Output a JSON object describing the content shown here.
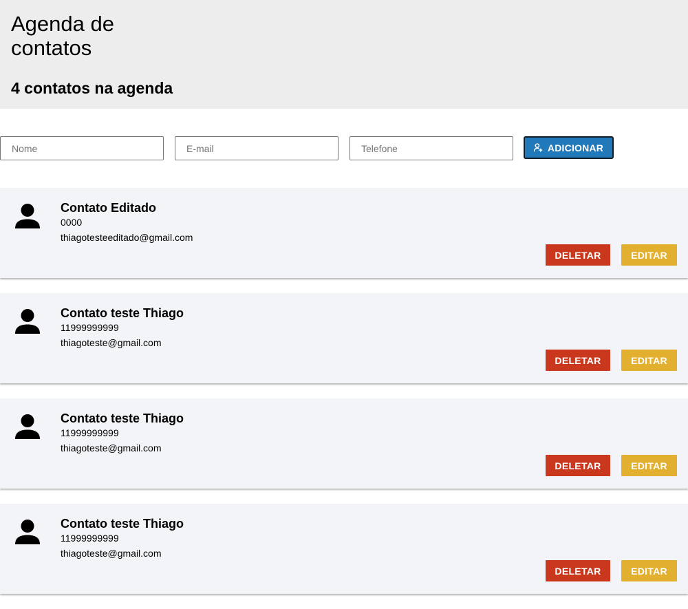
{
  "header": {
    "title": "Agenda de contatos",
    "count_text": "4 contatos na agenda"
  },
  "form": {
    "name_placeholder": "Nome",
    "email_placeholder": "E-mail",
    "phone_placeholder": "Telefone",
    "name_value": "",
    "email_value": "",
    "phone_value": "",
    "add_label": "ADICIONAR",
    "add_icon": "add-user-icon"
  },
  "contacts": [
    {
      "name": "Contato Editado",
      "phone": "0000",
      "email": "thiagotesteeditado@gmail.com",
      "delete_label": "DELETAR",
      "edit_label": "EDITAR",
      "avatar_icon": "person-icon"
    },
    {
      "name": "Contato teste Thiago",
      "phone": "11999999999",
      "email": "thiagoteste@gmail.com",
      "delete_label": "DELETAR",
      "edit_label": "EDITAR",
      "avatar_icon": "person-icon"
    },
    {
      "name": "Contato teste Thiago",
      "phone": "11999999999",
      "email": "thiagoteste@gmail.com",
      "delete_label": "DELETAR",
      "edit_label": "EDITAR",
      "avatar_icon": "person-icon"
    },
    {
      "name": "Contato teste Thiago",
      "phone": "11999999999",
      "email": "thiagoteste@gmail.com",
      "delete_label": "DELETAR",
      "edit_label": "EDITAR",
      "avatar_icon": "person-icon"
    }
  ],
  "colors": {
    "header_bg": "#ededed",
    "card_bg": "#f3f4f7",
    "add_button": "#2279b9",
    "delete_button": "#c9381c",
    "edit_button": "#e2b02e"
  }
}
